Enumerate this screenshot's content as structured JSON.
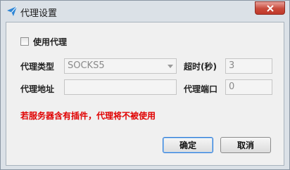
{
  "window": {
    "title": "代理设置"
  },
  "proxy": {
    "use_proxy_label": "使用代理",
    "use_proxy_checked": false,
    "type_label": "代理类型",
    "type_value": "SOCKS5",
    "timeout_label": "超时(秒)",
    "timeout_value": "3",
    "address_label": "代理地址",
    "address_value": "",
    "port_label": "代理端口",
    "port_value": "0",
    "warning": "若服务器含有插件，代理将不被使用"
  },
  "buttons": {
    "ok": "确定",
    "cancel": "取消"
  },
  "colors": {
    "warning": "#e00000",
    "close_button": "#c84a3b"
  }
}
